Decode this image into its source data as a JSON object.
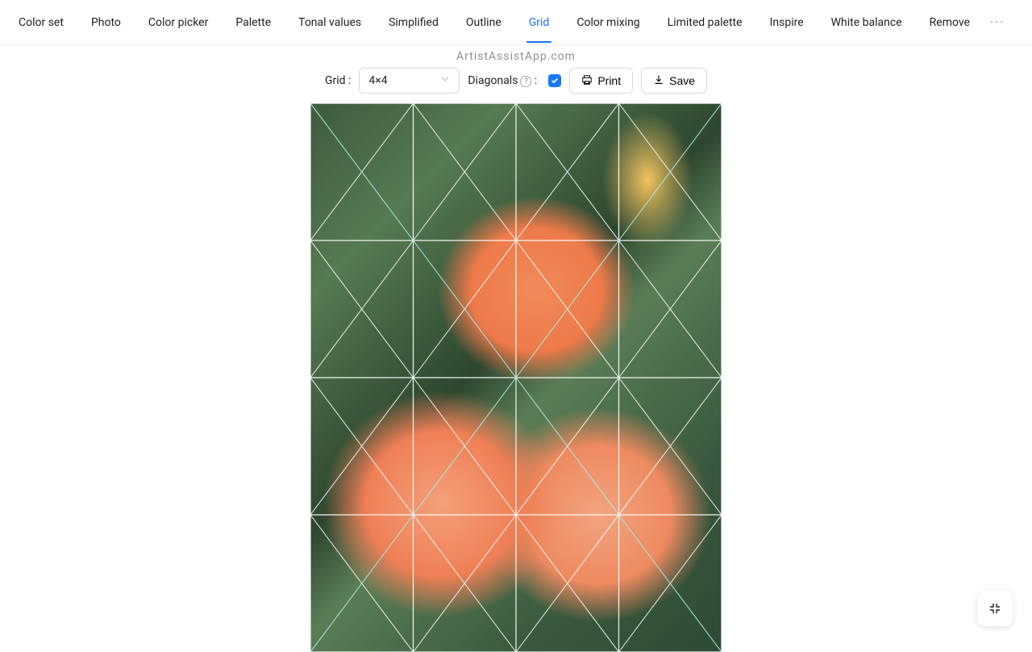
{
  "watermark": "ArtistAssistApp.com",
  "tabs": [
    {
      "label": "Color set",
      "active": false
    },
    {
      "label": "Photo",
      "active": false
    },
    {
      "label": "Color picker",
      "active": false
    },
    {
      "label": "Palette",
      "active": false
    },
    {
      "label": "Tonal values",
      "active": false
    },
    {
      "label": "Simplified",
      "active": false
    },
    {
      "label": "Outline",
      "active": false
    },
    {
      "label": "Grid",
      "active": true
    },
    {
      "label": "Color mixing",
      "active": false
    },
    {
      "label": "Limited palette",
      "active": false
    },
    {
      "label": "Inspire",
      "active": false
    },
    {
      "label": "White balance",
      "active": false
    },
    {
      "label": "Remove",
      "active": false
    }
  ],
  "toolbar": {
    "grid_label": "Grid :",
    "grid_value": "4×4",
    "diagonals_label": "Diagonals",
    "diagonals_checked": true,
    "print_label": "Print",
    "save_label": "Save"
  },
  "grid": {
    "cols": 4,
    "rows": 4,
    "diagonals": true
  }
}
